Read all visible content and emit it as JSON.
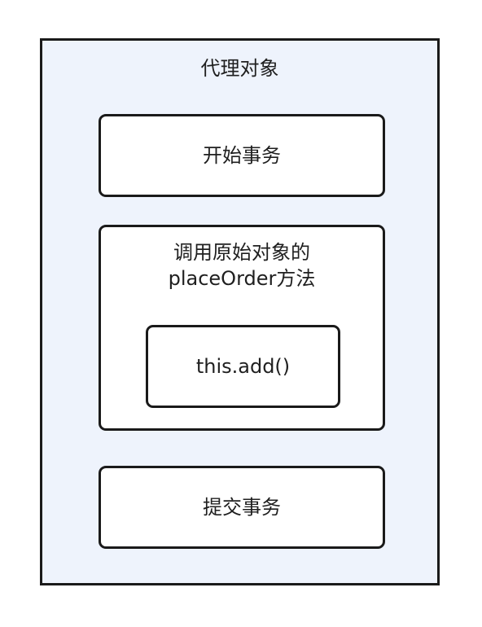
{
  "diagram": {
    "outer_title": "代理对象",
    "start_transaction": "开始事务",
    "call_original": {
      "line1": "调用原始对象的",
      "line2": "placeOrder方法"
    },
    "inner_call": "this.add()",
    "commit_transaction": "提交事务"
  },
  "colors": {
    "outer_fill": "#eef3fc",
    "box_fill": "#ffffff",
    "stroke": "#1a1a1a"
  }
}
